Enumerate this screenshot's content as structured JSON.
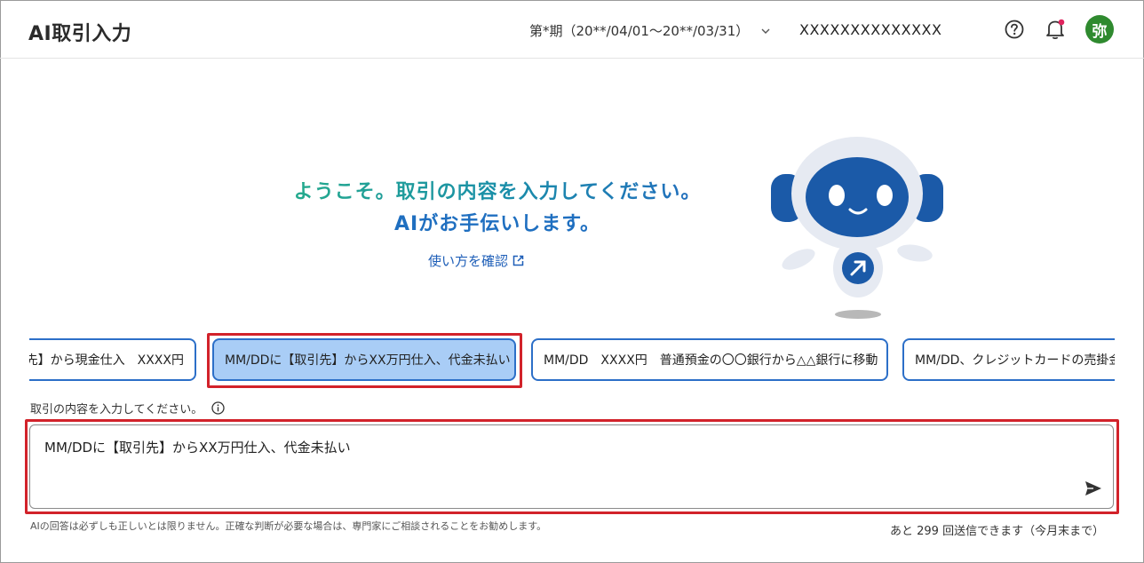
{
  "header": {
    "title": "AI取引入力",
    "period": "第*期（20**/04/01～20**/03/31）",
    "company": "XXXXXXXXXXXXXX",
    "avatar": "弥",
    "icons": [
      "help-icon",
      "bell-icon",
      "chevron-down-icon"
    ]
  },
  "welcome": {
    "line1": "ようこそ。取引の内容を入力してください。",
    "line2": "AIがお手伝いします。",
    "howto": "使い方を確認"
  },
  "suggestions": [
    {
      "label": "引先】から現金仕入　XXXX円"
    },
    {
      "label": "MM/DDに【取引先】からXX万円仕入、代金未払い",
      "selected": true
    },
    {
      "label": "MM/DD　XXXX円　普通預金の〇〇銀行から△△銀行に移動"
    },
    {
      "label": "MM/DD、クレジットカードの売掛金"
    }
  ],
  "input": {
    "label": "取引の内容を入力してください。",
    "value": "MM/DDに【取引先】からXX万円仕入、代金未払い"
  },
  "footer": {
    "disclaimer": "AIの回答は必ずしも正しいとは限りません。正確な判断が必要な場合は、専門家にご相談されることをお勧めします。",
    "remaining": "あと 299 回送信できます（今月末まで）"
  },
  "colors": {
    "accent": "#2c6fc8",
    "selected_chip": "#a9cdf6",
    "highlight": "#d2222a",
    "avatar": "#2f8a2f",
    "robot": "#1b5aa8"
  }
}
